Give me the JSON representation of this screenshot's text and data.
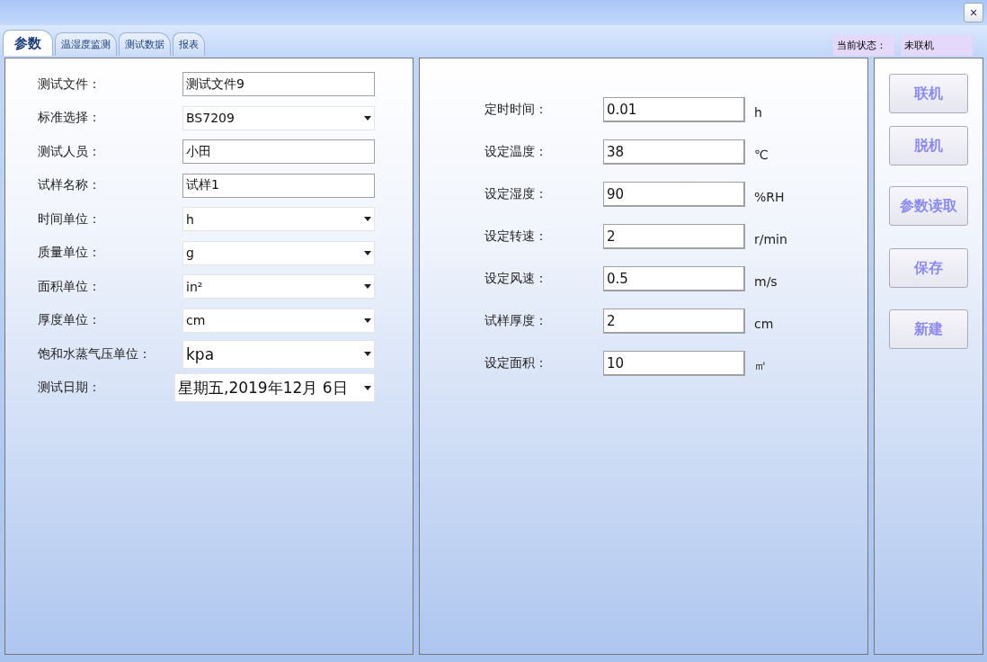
{
  "window": {
    "close": "×"
  },
  "tabs": [
    {
      "label": "参数",
      "selected": true
    },
    {
      "label": "温湿度监测",
      "selected": false
    },
    {
      "label": "测试数据",
      "selected": false
    },
    {
      "label": "报表",
      "selected": false
    }
  ],
  "status": {
    "label": "当前状态：",
    "value": "未联机"
  },
  "left_form": [
    {
      "label": "测试文件：",
      "kind": "text",
      "value": "测试文件9"
    },
    {
      "label": "标准选择：",
      "kind": "select",
      "value": "BS7209"
    },
    {
      "label": "测试人员：",
      "kind": "text",
      "value": "小田"
    },
    {
      "label": "试样名称：",
      "kind": "text",
      "value": "试样1"
    },
    {
      "label": "时间单位：",
      "kind": "select",
      "value": "h"
    },
    {
      "label": "质量单位：",
      "kind": "select",
      "value": "g"
    },
    {
      "label": "面积单位：",
      "kind": "select",
      "value": "in²"
    },
    {
      "label": "厚度单位：",
      "kind": "select",
      "value": "cm"
    },
    {
      "label": "饱和水蒸气压单位：",
      "kind": "select",
      "value": "kpa"
    },
    {
      "label": "测试日期：",
      "kind": "date",
      "value": "星期五,2019年12月  6日"
    }
  ],
  "settings": [
    {
      "label": "定时时间：",
      "value": "0.01",
      "unit": "h"
    },
    {
      "label": "设定温度：",
      "value": "38",
      "unit": "℃"
    },
    {
      "label": "设定湿度：",
      "value": "90",
      "unit": "%RH"
    },
    {
      "label": "设定转速：",
      "value": "2",
      "unit": "r/min"
    },
    {
      "label": "设定风速：",
      "value": "0.5",
      "unit": "m/s"
    },
    {
      "label": "试样厚度：",
      "value": "2",
      "unit": "cm"
    },
    {
      "label": "设定面积：",
      "value": "10",
      "unit": "㎡"
    }
  ],
  "buttons": [
    {
      "label": "联机",
      "disabled": true
    },
    {
      "label": "脱机",
      "disabled": true
    },
    {
      "label": "参数读取",
      "disabled": true
    },
    {
      "label": "保存",
      "disabled": true
    },
    {
      "label": "新建",
      "disabled": true
    }
  ]
}
